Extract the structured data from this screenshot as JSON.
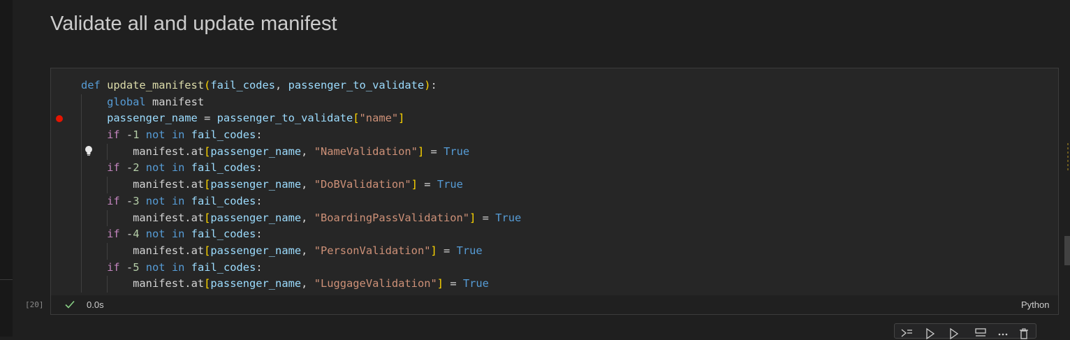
{
  "markdown": {
    "heading": "Validate all and update manifest"
  },
  "cell": {
    "execution_count": "[20]",
    "status": "success",
    "duration": "0.0s",
    "language": "Python",
    "breakpoint_line": 3,
    "lightbulb_line": 5,
    "code_lines": [
      "def update_manifest(fail_codes, passenger_to_validate):",
      "    global manifest",
      "    passenger_name = passenger_to_validate[\"name\"]",
      "    if -1 not in fail_codes:",
      "        manifest.at[passenger_name, \"NameValidation\"] = True",
      "    if -2 not in fail_codes:",
      "        manifest.at[passenger_name, \"DoBValidation\"] = True",
      "    if -3 not in fail_codes:",
      "        manifest.at[passenger_name, \"BoardingPassValidation\"] = True",
      "    if -4 not in fail_codes:",
      "        manifest.at[passenger_name, \"PersonValidation\"] = True",
      "    if -5 not in fail_codes:",
      "        manifest.at[passenger_name, \"LuggageValidation\"] = True"
    ]
  },
  "toolbar": {
    "icons": [
      "run-by-line-icon",
      "execute-above-icon",
      "execute-below-icon",
      "split-cell-icon",
      "more-actions-icon",
      "delete-cell-icon"
    ]
  },
  "colors": {
    "background": "#1f1f1f",
    "cell_background": "#262626",
    "keyword": "#569cd6",
    "control": "#c586c0",
    "function": "#dcdcaa",
    "variable": "#9cdcfe",
    "string": "#ce9178",
    "number": "#b5cea8",
    "bracket": "#ffd700",
    "breakpoint": "#e51400",
    "success": "#89d185"
  }
}
